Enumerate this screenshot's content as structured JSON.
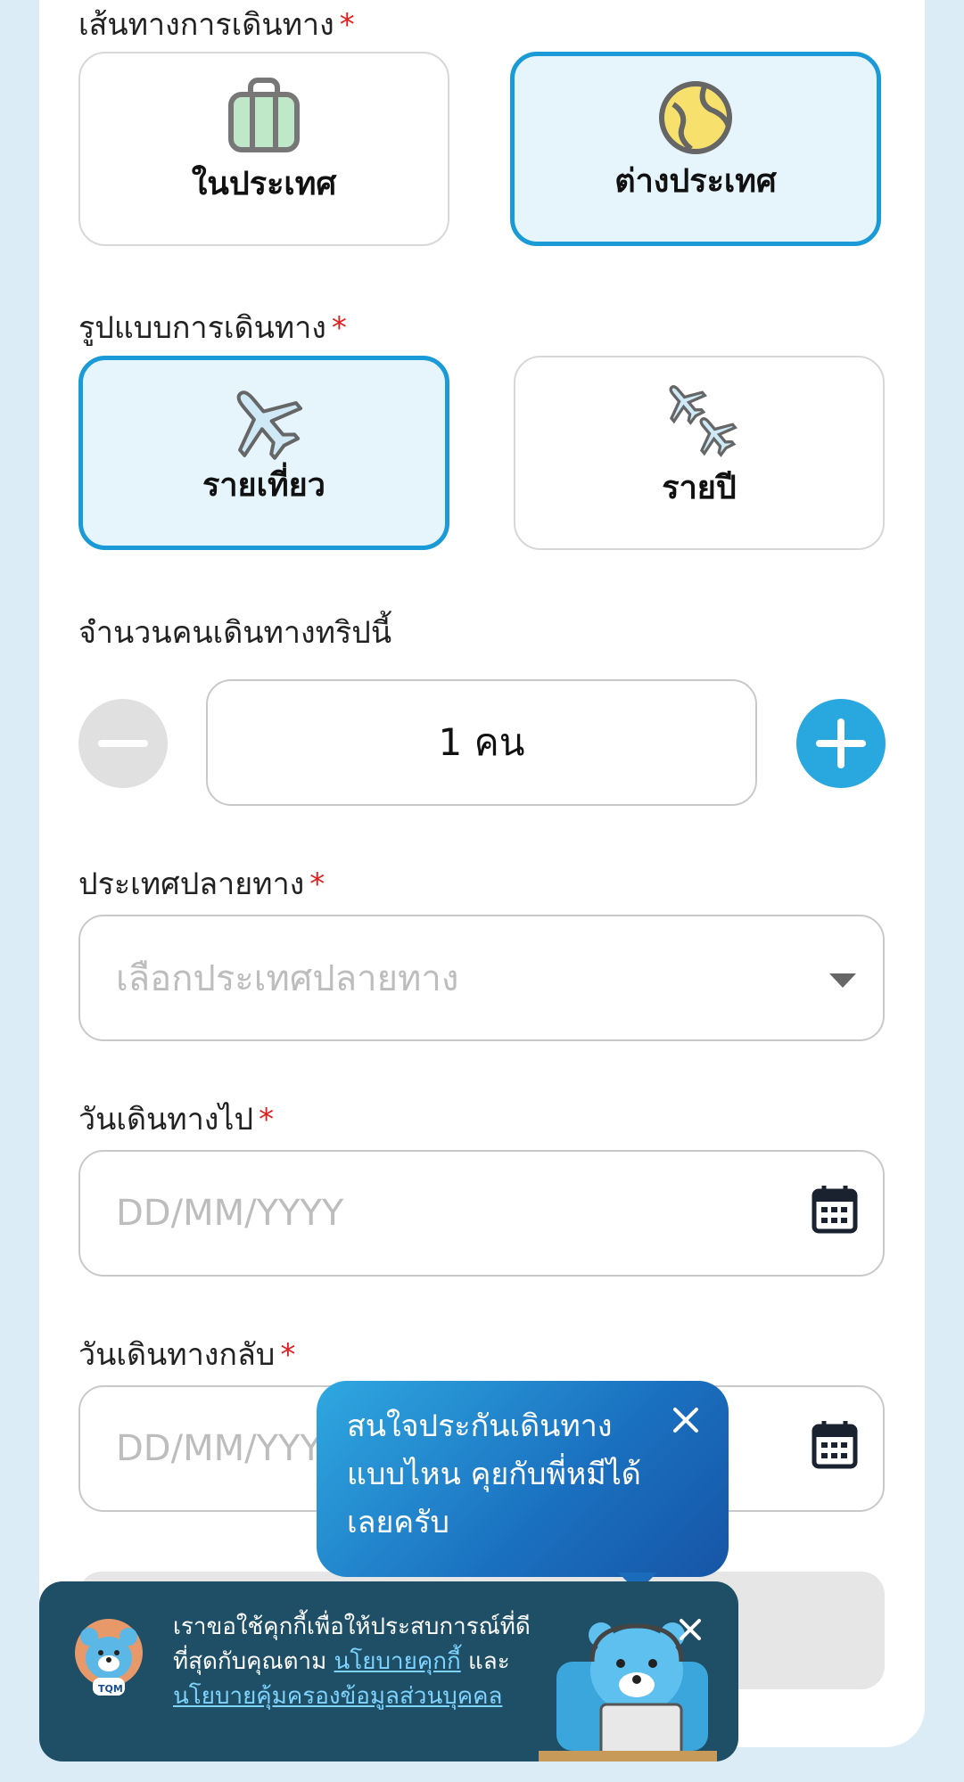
{
  "route": {
    "label": "เส้นทางการเดินทาง",
    "required_mark": "*",
    "options": [
      {
        "label": "ในประเทศ",
        "icon": "luggage-icon",
        "selected": false
      },
      {
        "label": "ต่างประเทศ",
        "icon": "globe-icon",
        "selected": true
      }
    ]
  },
  "trip_type": {
    "label": "รูปแบบการเดินทาง",
    "required_mark": "*",
    "options": [
      {
        "label": "รายเที่ยว",
        "icon": "airplane-icon",
        "selected": true
      },
      {
        "label": "รายปี",
        "icon": "two-airplanes-icon",
        "selected": false
      }
    ]
  },
  "travelers": {
    "label": "จำนวนคนเดินทางทริปนี้",
    "value": "1 คน"
  },
  "destination": {
    "label": "ประเทศปลายทาง",
    "required_mark": "*",
    "placeholder": "เลือกประเทศปลายทาง"
  },
  "depart_date": {
    "label": "วันเดินทางไป",
    "required_mark": "*",
    "placeholder": "DD/MM/YYYY"
  },
  "return_date": {
    "label": "วันเดินทางกลับ",
    "required_mark": "*",
    "placeholder": "DD/MM/YYYY"
  },
  "chat_bubble": {
    "line1": "สนใจประกันเดินทาง",
    "line2": "แบบไหน คุยกับพี่หมีได้",
    "line3": "เลยครับ"
  },
  "cookie_banner": {
    "text_before": "เราขอใช้คุกกี้เพื่อให้ประสบการณ์ที่ดีที่สุดกับคุณตาม",
    "cookie_policy_link": "นโยบายคุกกี้",
    "and": "และ",
    "privacy_policy_link": "นโยบายคุ้มครองข้อมูลส่วนบุคคล",
    "logo_text": "TQM"
  },
  "colors": {
    "accent": "#1a9ad6",
    "selected_bg": "#e6f4fb",
    "plus_button": "#29a8e0",
    "required": "#e02020",
    "cookie_bg": "#1e4f66"
  }
}
